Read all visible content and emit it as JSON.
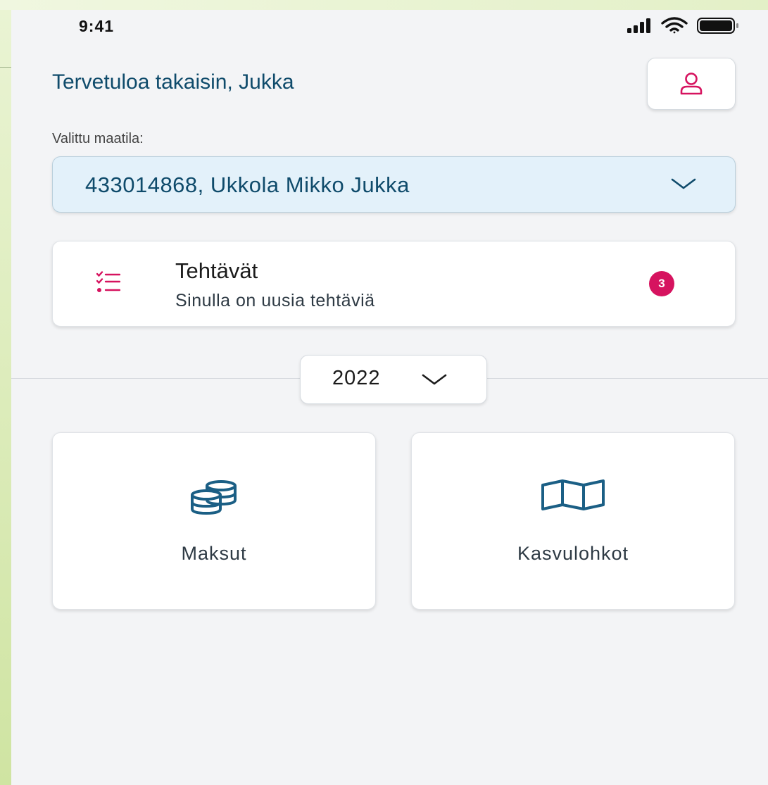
{
  "status_bar": {
    "time": "9:41"
  },
  "header": {
    "greeting": "Tervetuloa takaisin, Jukka"
  },
  "farm": {
    "label": "Valittu maatila:",
    "selected": "433014868, Ukkola Mikko Jukka"
  },
  "tasks": {
    "title": "Tehtävät",
    "subtitle": "Sinulla on uusia tehtäviä",
    "count": "3"
  },
  "year": {
    "selected": "2022"
  },
  "tiles": [
    {
      "label": "Maksut",
      "icon": "coins-icon"
    },
    {
      "label": "Kasvulohkot",
      "icon": "map-icon"
    }
  ],
  "colors": {
    "primary": "#0f4b6b",
    "accent": "#d6135f",
    "icon_blue": "#1b5f85",
    "select_bg": "#e3f1fa",
    "screen_bg": "#f3f4f6"
  }
}
